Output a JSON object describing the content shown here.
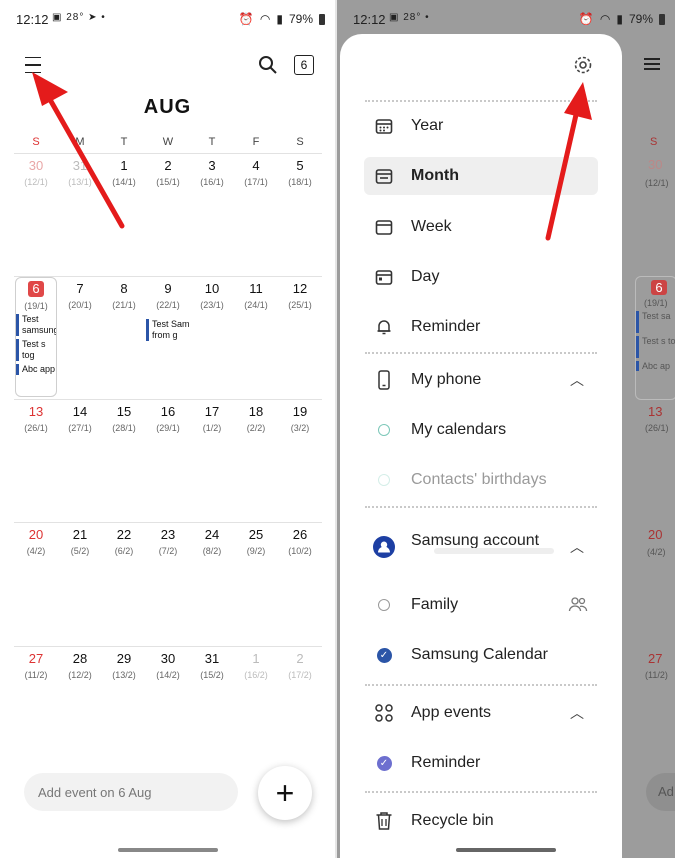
{
  "left": {
    "status": {
      "time": "12:12",
      "left_icons": "▣ 28° ➤ •",
      "battery": "79%"
    },
    "month": "AUG",
    "weekdays": [
      "S",
      "M",
      "T",
      "W",
      "T",
      "F",
      "S"
    ],
    "weeks": [
      {
        "days": [
          {
            "d": "30",
            "l": "(12/1)"
          },
          {
            "d": "31",
            "l": "(13/1)"
          },
          {
            "d": "1",
            "l": "(14/1)"
          },
          {
            "d": "2",
            "l": "(15/1)"
          },
          {
            "d": "3",
            "l": "(16/1)"
          },
          {
            "d": "4",
            "l": "(17/1)"
          },
          {
            "d": "5",
            "l": "(18/1)"
          }
        ]
      },
      {
        "days": [
          {
            "d": "6",
            "l": "(19/1)"
          },
          {
            "d": "7",
            "l": "(20/1)"
          },
          {
            "d": "8",
            "l": "(21/1)"
          },
          {
            "d": "9",
            "l": "(22/1)"
          },
          {
            "d": "10",
            "l": "(23/1)"
          },
          {
            "d": "11",
            "l": "(24/1)"
          },
          {
            "d": "12",
            "l": "(25/1)"
          }
        ]
      },
      {
        "days": [
          {
            "d": "13",
            "l": "(26/1)"
          },
          {
            "d": "14",
            "l": "(27/1)"
          },
          {
            "d": "15",
            "l": "(28/1)"
          },
          {
            "d": "16",
            "l": "(29/1)"
          },
          {
            "d": "17",
            "l": "(1/2)"
          },
          {
            "d": "18",
            "l": "(2/2)"
          },
          {
            "d": "19",
            "l": "(3/2)"
          }
        ]
      },
      {
        "days": [
          {
            "d": "20",
            "l": "(4/2)"
          },
          {
            "d": "21",
            "l": "(5/2)"
          },
          {
            "d": "22",
            "l": "(6/2)"
          },
          {
            "d": "23",
            "l": "(7/2)"
          },
          {
            "d": "24",
            "l": "(8/2)"
          },
          {
            "d": "25",
            "l": "(9/2)"
          },
          {
            "d": "26",
            "l": "(10/2)"
          }
        ]
      },
      {
        "days": [
          {
            "d": "27",
            "l": "(11/2)"
          },
          {
            "d": "28",
            "l": "(12/2)"
          },
          {
            "d": "29",
            "l": "(13/2)"
          },
          {
            "d": "30",
            "l": "(14/2)"
          },
          {
            "d": "31",
            "l": "(15/2)"
          },
          {
            "d": "1",
            "l": "(16/2)"
          },
          {
            "d": "2",
            "l": "(17/2)"
          }
        ]
      }
    ],
    "events_6": [
      "Test samsung",
      "Test s tog",
      "Abc app"
    ],
    "events_9": [
      "Test Sam from g"
    ],
    "today_badge": "6",
    "add_placeholder": "Add event on 6 Aug",
    "fab": "+"
  },
  "right": {
    "status": {
      "time": "12:12",
      "left_icons": "▣ 28° •",
      "battery": "79%"
    },
    "menu": {
      "year": "Year",
      "month": "Month",
      "week": "Week",
      "day": "Day",
      "reminder": "Reminder",
      "my_phone": "My phone",
      "my_calendars": "My calendars",
      "contacts_birthdays": "Contacts' birthdays",
      "samsung_account": "Samsung account",
      "family": "Family",
      "samsung_calendar": "Samsung Calendar",
      "app_events": "App events",
      "reminder2": "Reminder",
      "recycle_bin": "Recycle bin"
    },
    "dim": {
      "s": "S",
      "n1": "6",
      "l1": "(19/1)",
      "e1": "Test sa",
      "e2": "Test s to",
      "e3": "Abc ap",
      "l13": "(26/1)",
      "n20": "20",
      "l20": "(4/2)",
      "n27": "27",
      "l27": "(11/2)",
      "n30": "30",
      "l30": "(12/1)",
      "n13": "13",
      "add": "Ad"
    }
  },
  "colors": {
    "accent": "#2b55a7",
    "today": "#e04848",
    "arrow": "#e41b1b"
  }
}
